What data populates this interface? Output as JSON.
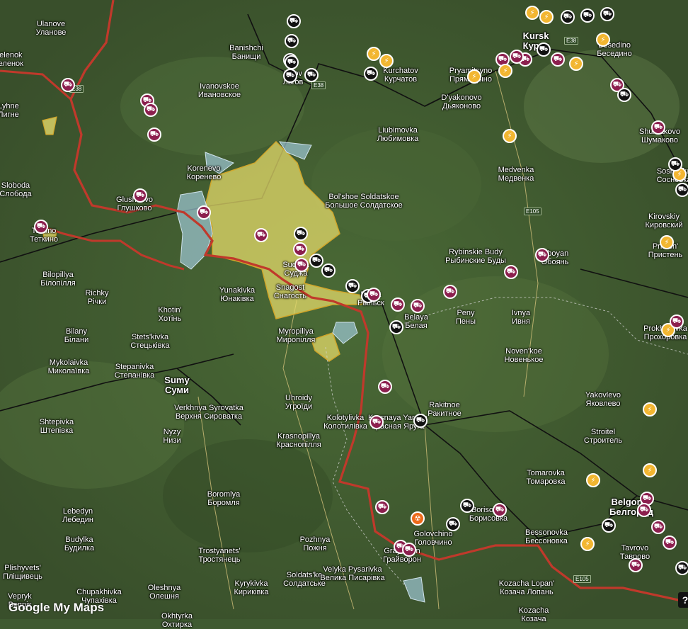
{
  "map": {
    "provider_logo": "Google My Maps",
    "help_button": "?",
    "roads": [
      "E38",
      "E38",
      "E105",
      "E105",
      "E105",
      "E38"
    ],
    "places": [
      {
        "name": "Ulanove",
        "alt": "Уланове"
      },
      {
        "name": "Banishchi",
        "alt": "Банищи"
      },
      {
        "name": "Ivanovskoe",
        "alt": "Ивановское"
      },
      {
        "name": "Korenevo",
        "alt": "Коренево"
      },
      {
        "name": "Glushkovo",
        "alt": "Глушково"
      },
      {
        "name": "Sloboda",
        "alt": "Слобода"
      },
      {
        "name": "Bilopillya",
        "alt": "Білопілля"
      },
      {
        "name": "Richky",
        "alt": "Річки"
      },
      {
        "name": "Khotin'",
        "alt": "Хотінь"
      },
      {
        "name": "Yunakivka",
        "alt": "Юнаківка"
      },
      {
        "name": "Myropillya",
        "alt": "Миропілля"
      },
      {
        "name": "Bilany",
        "alt": "Білани"
      },
      {
        "name": "Mykolaivka",
        "alt": "Миколаївка"
      },
      {
        "name": "Stets'kivka",
        "alt": "Стецьківка"
      },
      {
        "name": "Stepanivka",
        "alt": "Степанівка"
      },
      {
        "name": "Sumy",
        "alt": "Суми"
      },
      {
        "name": "Verkhnya Syrovatka",
        "alt": "Верхня Сироватка"
      },
      {
        "name": "Uhroidy",
        "alt": "Угроїди"
      },
      {
        "name": "Shtepivka",
        "alt": "Штепівка"
      },
      {
        "name": "Nyzy",
        "alt": "Низи"
      },
      {
        "name": "Krasnopillya",
        "alt": "Краснопілля"
      },
      {
        "name": "Kolotylivka",
        "alt": "Колотилівка"
      },
      {
        "name": "Krasnaya Yaruga",
        "alt": "Красная Яруга"
      },
      {
        "name": "Rakitnoe",
        "alt": "Ракитное"
      },
      {
        "name": "Boromlya",
        "alt": "Боромля"
      },
      {
        "name": "Lebedyn",
        "alt": "Лебедин"
      },
      {
        "name": "Budylka",
        "alt": "Будилка"
      },
      {
        "name": "Plishyvets'",
        "alt": "Пліщивець"
      },
      {
        "name": "Trostyanets'",
        "alt": "Тростянець"
      },
      {
        "name": "Pozhnya",
        "alt": "Пожня"
      },
      {
        "name": "Soldats'ke",
        "alt": "Солдатське"
      },
      {
        "name": "Velyka Pysarivka",
        "alt": "Велика Писарівка"
      },
      {
        "name": "Oleshnya",
        "alt": "Олешня"
      },
      {
        "name": "Chupakhivka",
        "alt": "Чупахівка"
      },
      {
        "name": "Kyrykivka",
        "alt": "Кириківка"
      },
      {
        "name": "Okhtyrka",
        "alt": "Охтирка"
      },
      {
        "name": "Veprуk",
        "alt": "Вепрік"
      },
      {
        "name": "Kurchatov",
        "alt": "Курчатов"
      },
      {
        "name": "D'yakonovo",
        "alt": "Дьяконово"
      },
      {
        "name": "Liubimovka",
        "alt": "Любимовка"
      },
      {
        "name": "Bol'shoe Soldatskoe",
        "alt": "Большое Солдатское"
      },
      {
        "name": "Medvenka",
        "alt": "Медвенка"
      },
      {
        "name": "Rybinskie Budy",
        "alt": "Рыбинские Буды"
      },
      {
        "name": "Oboyan",
        "alt": "Обоянь"
      },
      {
        "name": "Peny",
        "alt": "Пены"
      },
      {
        "name": "Ivnya",
        "alt": "Ивня"
      },
      {
        "name": "Belaya",
        "alt": "Белая"
      },
      {
        "name": "Noven'koe",
        "alt": "Новенькое"
      },
      {
        "name": "Kursk",
        "alt": "Курск"
      },
      {
        "name": "Besedino",
        "alt": "Беседино"
      },
      {
        "name": "Pryamitsyno",
        "alt": "Прямицыно"
      },
      {
        "name": "Shumakovo",
        "alt": "Шумаково"
      },
      {
        "name": "Kirovskiy",
        "alt": "Кировский"
      },
      {
        "name": "Yakovlevo",
        "alt": "Яковлево"
      },
      {
        "name": "Stroitel",
        "alt": "Строитель"
      },
      {
        "name": "Tomarovka",
        "alt": "Томаровка"
      },
      {
        "name": "Borisovka",
        "alt": "Борисовка"
      },
      {
        "name": "Golovchino",
        "alt": "Головчино"
      },
      {
        "name": "Grayvoron",
        "alt": "Грайворон"
      },
      {
        "name": "Bessonovka",
        "alt": "Бессоновка"
      },
      {
        "name": "Belgorod",
        "alt": "Белгород"
      },
      {
        "name": "Kozacha Lopan'",
        "alt": "Козача Лопань"
      },
      {
        "name": "Tavrovo",
        "alt": "Таврово"
      },
      {
        "name": "Prokhorovka",
        "alt": "Прохоровка"
      },
      {
        "name": "Pristen'",
        "alt": "Пристень"
      },
      {
        "name": "Tetkino",
        "alt": "Теткино"
      },
      {
        "name": "Lyhne",
        "alt": "Лигне"
      },
      {
        "name": "Zelenok",
        "alt": "Зеленок"
      },
      {
        "name": "Sudzha",
        "alt": "Суджа"
      },
      {
        "name": "Snagost",
        "alt": "Снагость"
      },
      {
        "name": "Ryl'sk",
        "alt": "Рыльск"
      },
      {
        "name": "L'gov",
        "alt": "Льгов"
      },
      {
        "name": "Kozacha",
        "alt": "Козача"
      },
      {
        "name": "Sosnovka",
        "alt": "Сосновка"
      }
    ],
    "colors": {
      "border": "#c0392b",
      "occupied": "#e3d96a",
      "contested": "#9ec7d6",
      "infrastructure": "#8c1f4e",
      "bridge": "#111111",
      "energy": "#f2b631",
      "nuclear": "#ec6a1a"
    }
  }
}
